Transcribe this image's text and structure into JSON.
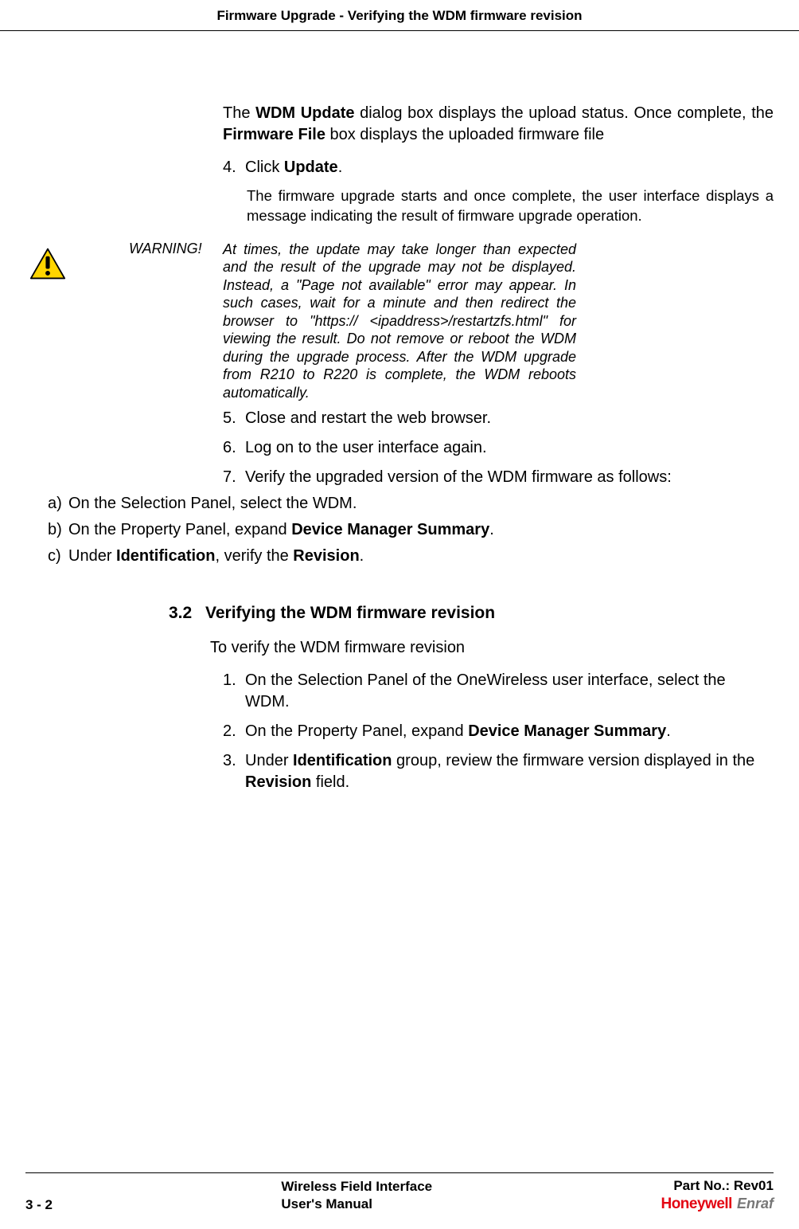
{
  "header": {
    "title": "Firmware Upgrade - Verifying the WDM firmware revision"
  },
  "content": {
    "intro_part1": "The ",
    "intro_bold1": "WDM Update",
    "intro_part2": " dialog box displays the upload status. Once complete, the ",
    "intro_bold2": "Firmware File",
    "intro_part3": " box displays the uploaded firmware file",
    "step4_num": "4.",
    "step4_text1": "Click ",
    "step4_bold": "Update",
    "step4_text2": ".",
    "step4_note": "The firmware upgrade starts and once complete, the user interface displays a message indicating the result of firmware upgrade operation.",
    "warning_label": "WARNING!",
    "warning_text": "At times, the update may take longer than expected and the result of the upgrade may not be displayed. Instead, a \"Page not available\" error may appear. In such cases, wait for a minute and then redirect the browser to \"https:// <ipaddress>/restartzfs.html\" for viewing the result. Do not remove or reboot the WDM during the upgrade process. After the WDM upgrade from R210 to R220 is complete, the WDM reboots automatically.",
    "step5_num": "5.",
    "step5_text": "Close and restart the web browser.",
    "step6_num": "6.",
    "step6_text": "Log on to the user interface again.",
    "step7_num": "7.",
    "step7_text": "Verify the upgraded version of the WDM firmware as follows:",
    "step7a_num": "a)",
    "step7a_text": "On the Selection Panel, select the WDM.",
    "step7b_num": "b)",
    "step7b_text1": "On the Property Panel, expand ",
    "step7b_bold": "Device Manager Summary",
    "step7b_text2": ".",
    "step7c_num": "c)",
    "step7c_text1": "Under ",
    "step7c_bold1": "Identification",
    "step7c_text2": ", verify the ",
    "step7c_bold2": "Revision",
    "step7c_text3": ".",
    "section_num": "3.2",
    "section_title": "Verifying the WDM firmware revision",
    "section_sub": "To verify the WDM firmware revision",
    "s2_step1_num": "1.",
    "s2_step1_text": "On the Selection Panel of the OneWireless user interface, select the WDM.",
    "s2_step2_num": "2.",
    "s2_step2_text1": "On the Property Panel, expand ",
    "s2_step2_bold": "Device Manager Summary",
    "s2_step2_text2": ".",
    "s2_step3_num": "3.",
    "s2_step3_text1": "Under ",
    "s2_step3_bold1": "Identification",
    "s2_step3_text2": " group, review the firmware version displayed in the ",
    "s2_step3_bold2": "Revision",
    "s2_step3_text3": " field."
  },
  "footer": {
    "page_num": "3 - 2",
    "doc_title_line1": "Wireless Field Interface",
    "doc_title_line2": "User's Manual",
    "part_no": "Part No.: Rev01",
    "brand1": "Honeywell",
    "brand2": "Enraf"
  }
}
